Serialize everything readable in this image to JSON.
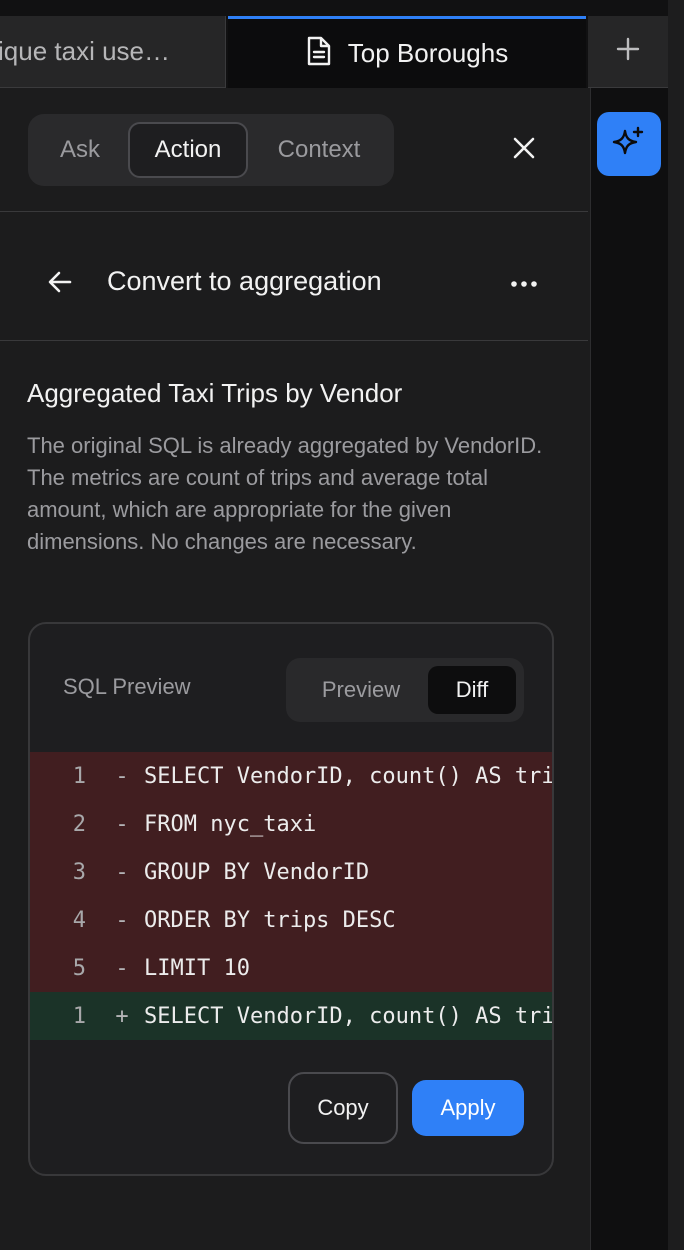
{
  "tabs": [
    {
      "label": "ique taxi use…",
      "active": false
    },
    {
      "label": "Top Boroughs",
      "active": true,
      "icon": "document-icon"
    }
  ],
  "new_tab_icon": "plus-icon",
  "ai_button_icon": "sparkle-icon",
  "mode_switch": {
    "options": [
      "Ask",
      "Action",
      "Context"
    ],
    "selected": "Action"
  },
  "action_header": {
    "title": "Convert to aggregation",
    "back_icon": "arrow-left-icon",
    "more_icon": "ellipsis-icon"
  },
  "result": {
    "title": "Aggregated Taxi Trips by Vendor",
    "description": "The original SQL is already aggregated by VendorID. The metrics are count of trips and average total amount, which are appropriate for the given dimensions. No changes are necessary."
  },
  "sql_card": {
    "label": "SQL Preview",
    "view_options": [
      "Preview",
      "Diff"
    ],
    "selected_view": "Diff",
    "diff_lines": [
      {
        "line": "1",
        "marker": "-",
        "type": "del",
        "code": "SELECT VendorID, count() AS trips"
      },
      {
        "line": "2",
        "marker": "-",
        "type": "del",
        "code": "FROM nyc_taxi"
      },
      {
        "line": "3",
        "marker": "-",
        "type": "del",
        "code": "GROUP BY VendorID"
      },
      {
        "line": "4",
        "marker": "-",
        "type": "del",
        "code": "ORDER BY trips DESC"
      },
      {
        "line": "5",
        "marker": "-",
        "type": "del",
        "code": "LIMIT 10"
      },
      {
        "line": "1",
        "marker": "+",
        "type": "add",
        "code": "SELECT VendorID, count() AS trips"
      }
    ],
    "copy_label": "Copy",
    "apply_label": "Apply"
  },
  "colors": {
    "accent": "#2f80f7",
    "deleted_line": "#411e20",
    "added_line": "#1b3328"
  }
}
